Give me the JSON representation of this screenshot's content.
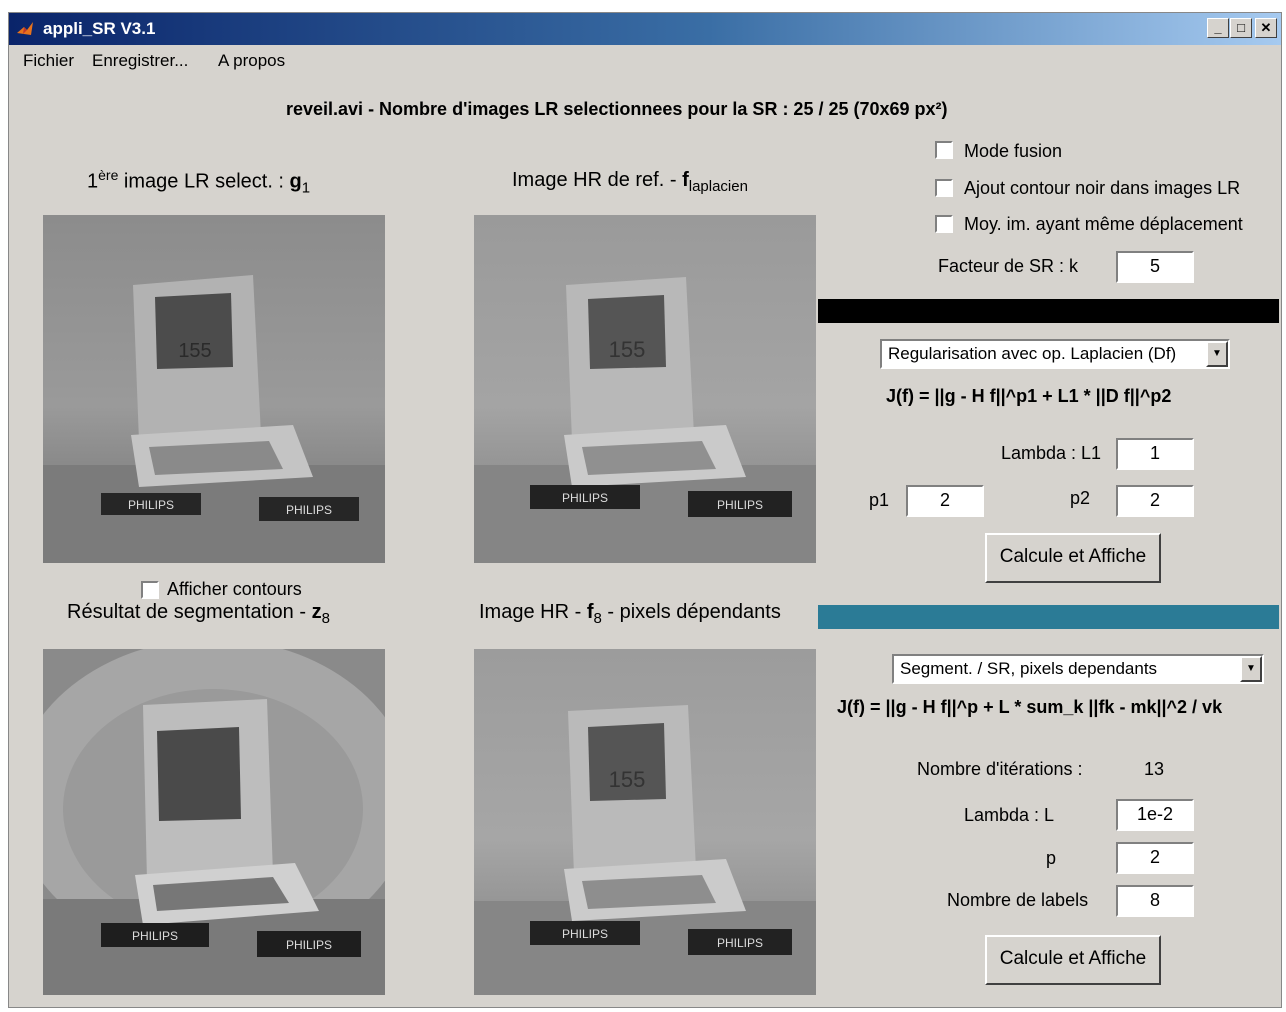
{
  "window": {
    "title": "appli_SR V3.1",
    "buttons": {
      "minimize": "_",
      "maximize": "□",
      "close": "✕"
    }
  },
  "menu": {
    "items": [
      "Fichier",
      "Enregistrer...",
      "A propos"
    ]
  },
  "header": {
    "summary": "reveil.avi - Nombre d'images LR selectionnees pour la SR : 25 / 25 (70x69 px²)"
  },
  "panels": {
    "lr_first": {
      "prefix": "1",
      "sup": "ère",
      "text": " image LR select. :  ",
      "var": "g",
      "sub": "1"
    },
    "hr_ref": {
      "text": "Image HR de ref. -  ",
      "var": "f",
      "sub": "laplacien"
    },
    "segmentation": {
      "text": "Résultat de segmentation -  ",
      "var": "z",
      "sub": "8"
    },
    "hr_dep": {
      "text": "Image HR -  ",
      "var": "f",
      "sub": "8",
      "suffix": " - pixels dépendants"
    },
    "show_contours": {
      "label": "Afficher contours",
      "checked": false
    }
  },
  "options": {
    "mode_fusion": {
      "label": "Mode fusion",
      "checked": false
    },
    "ajout_contour": {
      "label": "Ajout contour noir dans images LR",
      "checked": false
    },
    "moy_im": {
      "label": "Moy. im. ayant même déplacement",
      "checked": false
    },
    "facteur": {
      "label": "Facteur de SR : k",
      "value": "5"
    }
  },
  "section1": {
    "bar_color": "#000000",
    "method": "Regularisation avec op. Laplacien (Df)",
    "formula": "J(f) = ||g - H f||^p1 + L1 * ||D f||^p2",
    "lambda_label": "Lambda : L1",
    "lambda_value": "1",
    "p1_label": "p1",
    "p1_value": "2",
    "p2_label": "p2",
    "p2_value": "2",
    "button": "Calcule et Affiche"
  },
  "section2": {
    "bar_color": "#2b7b96",
    "method": "Segment. / SR, pixels dependants",
    "formula": "J(f) = ||g - H f||^p + L * sum_k ||fk - mk||^2 / vk",
    "iter_label": "Nombre d'itérations :",
    "iter_value": "13",
    "lambda_label": "Lambda : L",
    "lambda_value": "1e-2",
    "p_label": "p",
    "p_value": "2",
    "labels_label": "Nombre de labels",
    "labels_value": "8",
    "button": "Calcule et Affiche"
  },
  "images": {
    "label_text": "PHILIPS",
    "clock_digits": "155"
  }
}
